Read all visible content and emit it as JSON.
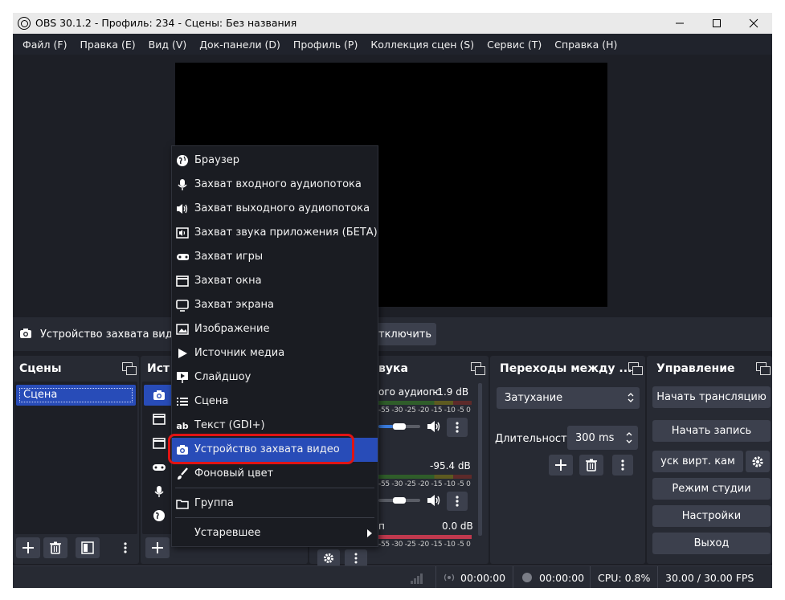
{
  "window": {
    "title": "OBS 30.1.2 - Профиль: 234 - Сцены: Без названия"
  },
  "menubar": [
    "Файл (F)",
    "Правка (E)",
    "Вид (V)",
    "Док-панели (D)",
    "Профиль (P)",
    "Коллекция сцен (S)",
    "Сервис (T)",
    "Справка (H)"
  ],
  "source_bar": {
    "label": "Устройство захвата видео",
    "deactivate": "тключить"
  },
  "scenes": {
    "title": "Сцены",
    "items": [
      "Сцена"
    ]
  },
  "sources": {
    "title": "Ист"
  },
  "mixer": {
    "title": "вука",
    "ch1": {
      "name": "ого аудиопс",
      "db": "-1.9 dB"
    },
    "ch2": {
      "db": "-95.4 dB"
    },
    "ch3": {
      "name": "п",
      "db": "0.0 dB"
    },
    "scale": "-55 -30 -25 -20 -15 -10 -5 0"
  },
  "transitions": {
    "title": "Переходы между ...",
    "selected": "Затухание",
    "duration_label": "Длительность",
    "duration_value": "300 ms"
  },
  "controls": {
    "title": "Управление",
    "buttons": [
      "Начать трансляцию",
      "Начать запись",
      "уск вирт. кам",
      "Режим студии",
      "Настройки",
      "Выход"
    ]
  },
  "status": {
    "time1": "00:00:00",
    "time2": "00:00:00",
    "cpu": "CPU: 0.8%",
    "fps": "30.00 / 30.00 FPS"
  },
  "context_menu": {
    "items": [
      "Браузер",
      "Захват входного аудиопотока",
      "Захват выходного аудиопотока",
      "Захват звука приложения (БЕТА)",
      "Захват игры",
      "Захват окна",
      "Захват экрана",
      "Изображение",
      "Источник медиа",
      "Слайдшоу",
      "Сцена",
      "Текст (GDI+)",
      "Устройство захвата видео",
      "Фоновый цвет"
    ],
    "group": "Группа",
    "deprecated": "Устаревшее"
  },
  "colors": {
    "accent": "#284cb8",
    "highlight_ring": "#e01414",
    "panel": "#272a33",
    "background": "#1d1f26"
  }
}
